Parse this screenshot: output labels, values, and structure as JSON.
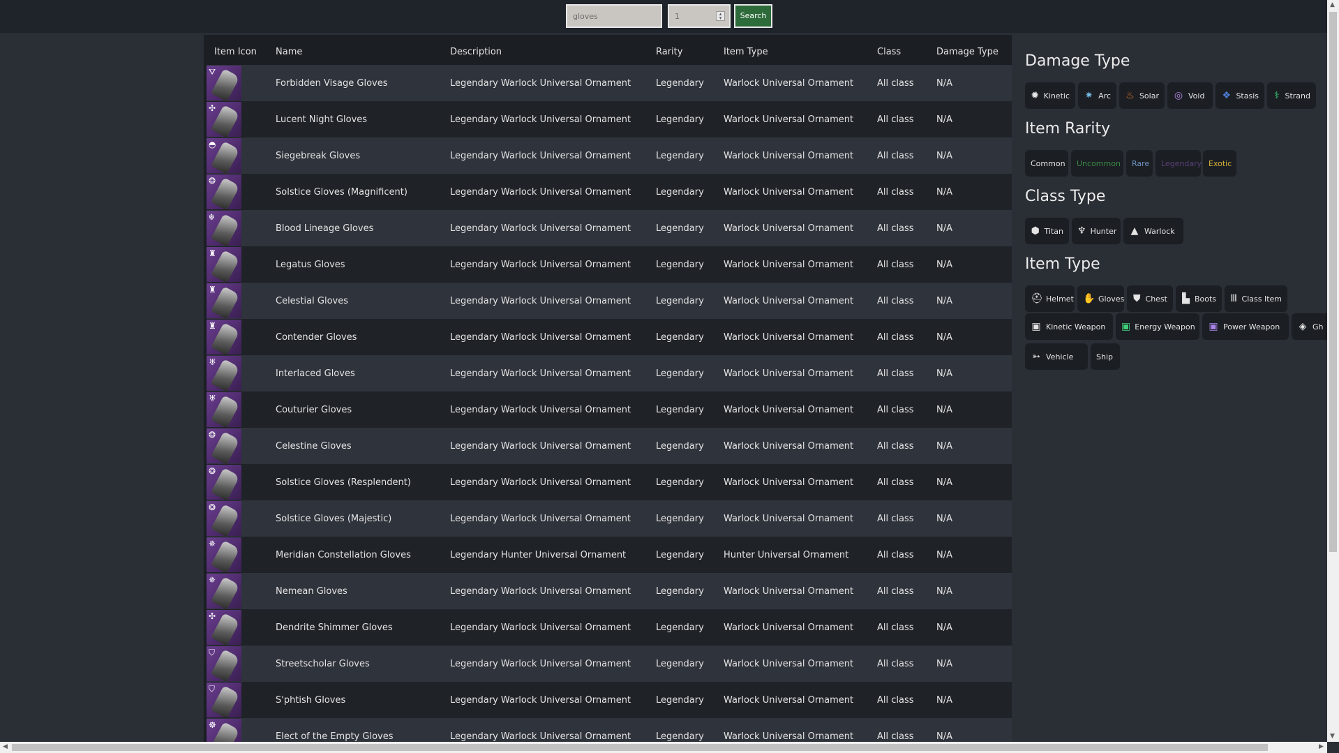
{
  "search": {
    "query": "gloves",
    "count": "1",
    "button_label": "Search"
  },
  "table": {
    "headers": [
      "Item Icon",
      "Name",
      "Description",
      "Rarity",
      "Item Type",
      "Class",
      "Damage Type"
    ],
    "rows": [
      {
        "emblem": "⛛",
        "name": "Forbidden Visage Gloves",
        "description": "Legendary Warlock Universal Ornament",
        "rarity": "Legendary",
        "item_type": "Warlock Universal Ornament",
        "class": "All class",
        "damage_type": "N/A"
      },
      {
        "emblem": "✣",
        "name": "Lucent Night Gloves",
        "description": "Legendary Warlock Universal Ornament",
        "rarity": "Legendary",
        "item_type": "Warlock Universal Ornament",
        "class": "All class",
        "damage_type": "N/A"
      },
      {
        "emblem": "◓",
        "name": "Siegebreak Gloves",
        "description": "Legendary Warlock Universal Ornament",
        "rarity": "Legendary",
        "item_type": "Warlock Universal Ornament",
        "class": "All class",
        "damage_type": "N/A"
      },
      {
        "emblem": "❂",
        "name": "Solstice Gloves (Magnificent)",
        "description": "Legendary Warlock Universal Ornament",
        "rarity": "Legendary",
        "item_type": "Warlock Universal Ornament",
        "class": "All class",
        "damage_type": "N/A"
      },
      {
        "emblem": "☬",
        "name": "Blood Lineage Gloves",
        "description": "Legendary Warlock Universal Ornament",
        "rarity": "Legendary",
        "item_type": "Warlock Universal Ornament",
        "class": "All class",
        "damage_type": "N/A"
      },
      {
        "emblem": "♜",
        "name": "Legatus Gloves",
        "description": "Legendary Warlock Universal Ornament",
        "rarity": "Legendary",
        "item_type": "Warlock Universal Ornament",
        "class": "All class",
        "damage_type": "N/A"
      },
      {
        "emblem": "♜",
        "name": "Celestial Gloves",
        "description": "Legendary Warlock Universal Ornament",
        "rarity": "Legendary",
        "item_type": "Warlock Universal Ornament",
        "class": "All class",
        "damage_type": "N/A"
      },
      {
        "emblem": "♜",
        "name": "Contender Gloves",
        "description": "Legendary Warlock Universal Ornament",
        "rarity": "Legendary",
        "item_type": "Warlock Universal Ornament",
        "class": "All class",
        "damage_type": "N/A"
      },
      {
        "emblem": "♅",
        "name": "Interlaced Gloves",
        "description": "Legendary Warlock Universal Ornament",
        "rarity": "Legendary",
        "item_type": "Warlock Universal Ornament",
        "class": "All class",
        "damage_type": "N/A"
      },
      {
        "emblem": "♅",
        "name": "Couturier Gloves",
        "description": "Legendary Warlock Universal Ornament",
        "rarity": "Legendary",
        "item_type": "Warlock Universal Ornament",
        "class": "All class",
        "damage_type": "N/A"
      },
      {
        "emblem": "❂",
        "name": "Celestine Gloves",
        "description": "Legendary Warlock Universal Ornament",
        "rarity": "Legendary",
        "item_type": "Warlock Universal Ornament",
        "class": "All class",
        "damage_type": "N/A"
      },
      {
        "emblem": "❂",
        "name": "Solstice Gloves (Resplendent)",
        "description": "Legendary Warlock Universal Ornament",
        "rarity": "Legendary",
        "item_type": "Warlock Universal Ornament",
        "class": "All class",
        "damage_type": "N/A"
      },
      {
        "emblem": "❂",
        "name": "Solstice Gloves (Majestic)",
        "description": "Legendary Warlock Universal Ornament",
        "rarity": "Legendary",
        "item_type": "Warlock Universal Ornament",
        "class": "All class",
        "damage_type": "N/A"
      },
      {
        "emblem": "✵",
        "name": "Meridian Constellation Gloves",
        "description": "Legendary Hunter Universal Ornament",
        "rarity": "Legendary",
        "item_type": "Hunter Universal Ornament",
        "class": "All class",
        "damage_type": "N/A"
      },
      {
        "emblem": "✵",
        "name": "Nemean Gloves",
        "description": "Legendary Warlock Universal Ornament",
        "rarity": "Legendary",
        "item_type": "Warlock Universal Ornament",
        "class": "All class",
        "damage_type": "N/A"
      },
      {
        "emblem": "✣",
        "name": "Dendrite Shimmer Gloves",
        "description": "Legendary Warlock Universal Ornament",
        "rarity": "Legendary",
        "item_type": "Warlock Universal Ornament",
        "class": "All class",
        "damage_type": "N/A"
      },
      {
        "emblem": "⛉",
        "name": "Streetscholar Gloves",
        "description": "Legendary Warlock Universal Ornament",
        "rarity": "Legendary",
        "item_type": "Warlock Universal Ornament",
        "class": "All class",
        "damage_type": "N/A"
      },
      {
        "emblem": "⛉",
        "name": "S'phtish Gloves",
        "description": "Legendary Warlock Universal Ornament",
        "rarity": "Legendary",
        "item_type": "Warlock Universal Ornament",
        "class": "All class",
        "damage_type": "N/A"
      },
      {
        "emblem": "☸",
        "name": "Elect of the Empty Gloves",
        "description": "Legendary Warlock Universal Ornament",
        "rarity": "Legendary",
        "item_type": "Warlock Universal Ornament",
        "class": "All class",
        "damage_type": "N/A"
      }
    ]
  },
  "filters": {
    "damage_type": {
      "title": "Damage Type",
      "chips": [
        {
          "label": "Kinetic",
          "icon": "✹",
          "color": "#e4e4e4"
        },
        {
          "label": "Arc",
          "icon": "✷",
          "color": "#79bde8"
        },
        {
          "label": "Solar",
          "icon": "♨",
          "color": "#f0802d"
        },
        {
          "label": "Void",
          "icon": "◎",
          "color": "#b088e0"
        },
        {
          "label": "Stasis",
          "icon": "❖",
          "color": "#4e7dd6"
        },
        {
          "label": "Strand",
          "icon": "⚕",
          "color": "#39d67a"
        }
      ]
    },
    "item_rarity": {
      "title": "Item Rarity",
      "chips": [
        {
          "label": "Common",
          "color": "#e4e4e4"
        },
        {
          "label": "Uncommon",
          "color": "#3a8a45"
        },
        {
          "label": "Rare",
          "color": "#6f93c0"
        },
        {
          "label": "Legendary",
          "color": "#5b3f78"
        },
        {
          "label": "Exotic",
          "color": "#d6b33a"
        }
      ]
    },
    "class_type": {
      "title": "Class Type",
      "chips": [
        {
          "label": "Titan",
          "icon": "⬢"
        },
        {
          "label": "Hunter",
          "icon": "♆"
        },
        {
          "label": "Warlock",
          "icon": "▲"
        }
      ]
    },
    "item_type": {
      "title": "Item Type",
      "chips": [
        {
          "label": "Helmet",
          "icon": "⛑"
        },
        {
          "label": "Gloves",
          "icon": "✋"
        },
        {
          "label": "Chest",
          "icon": "⛊"
        },
        {
          "label": "Boots",
          "icon": "▙"
        },
        {
          "label": "Class Item",
          "icon": "Ⅲ"
        },
        {
          "label": "Kinetic Weapon",
          "icon": "▣",
          "color": "#e4e4e4"
        },
        {
          "label": "Energy Weapon",
          "icon": "▣",
          "color": "#3fcf7a"
        },
        {
          "label": "Power Weapon",
          "icon": "▣",
          "color": "#a884e6"
        },
        {
          "label": "Gh",
          "icon": "◈"
        },
        {
          "label": "Vehicle",
          "icon": "➳"
        },
        {
          "label": "Ship",
          "icon": ""
        }
      ]
    }
  }
}
